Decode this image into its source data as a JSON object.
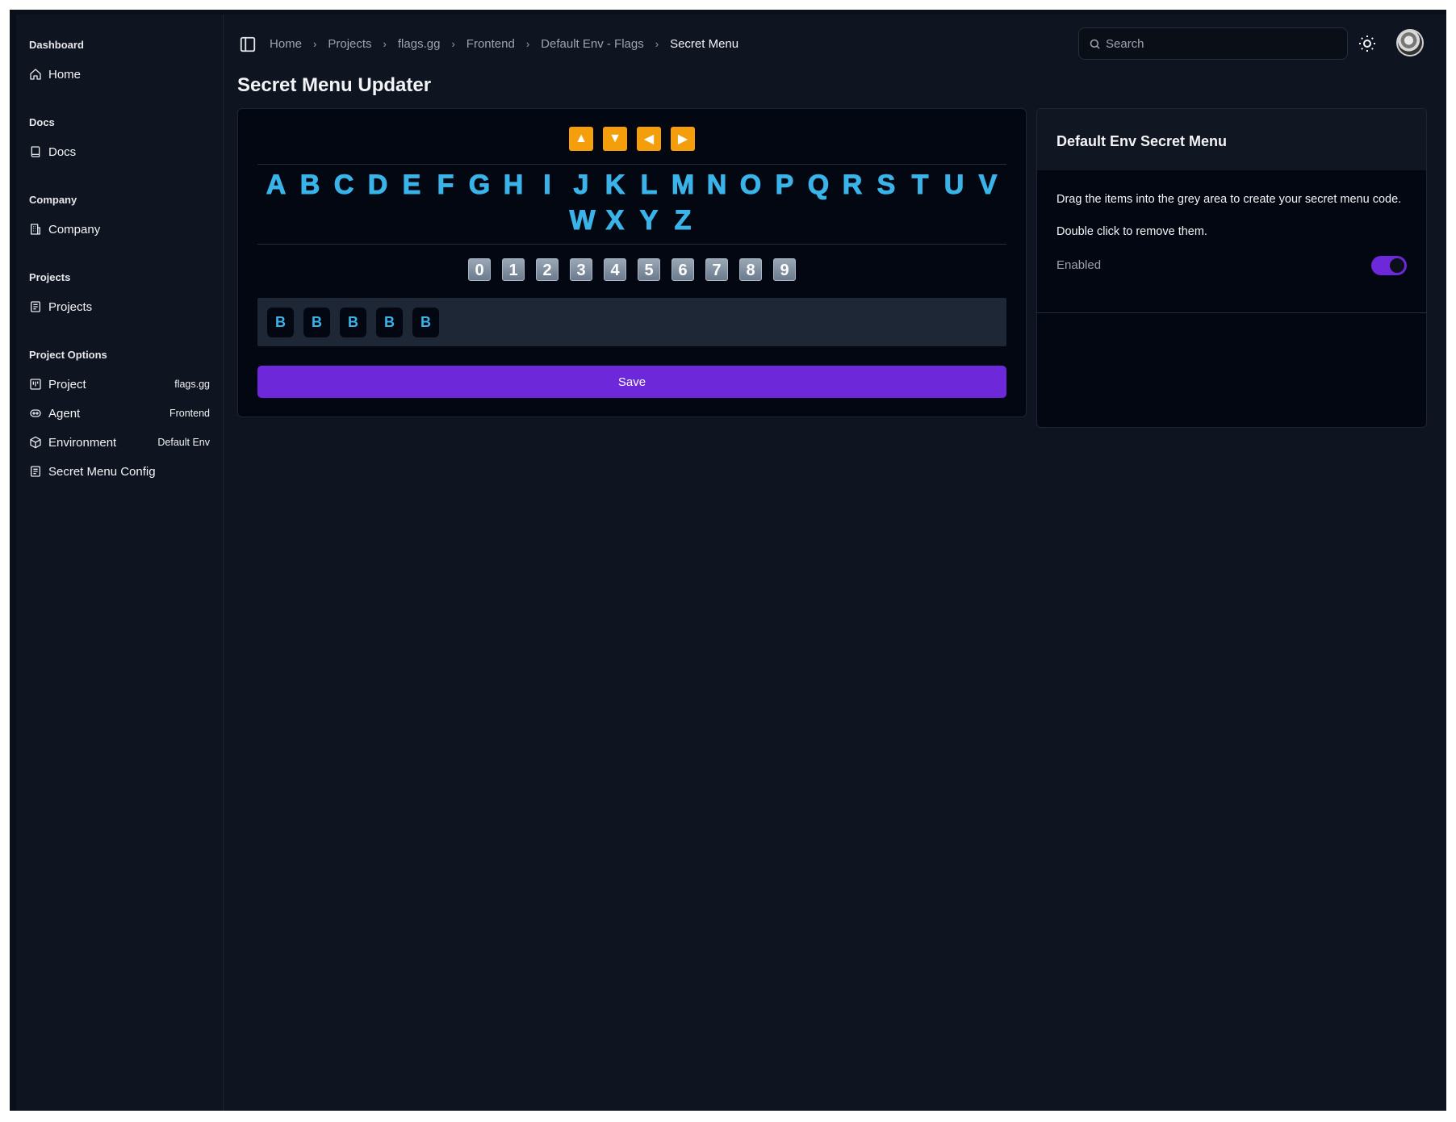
{
  "sidebar": {
    "sections": [
      {
        "label": "Dashboard",
        "items": [
          {
            "label": "Home",
            "icon": "home-icon",
            "meta": ""
          }
        ]
      },
      {
        "label": "Docs",
        "items": [
          {
            "label": "Docs",
            "icon": "book-icon",
            "meta": ""
          }
        ]
      },
      {
        "label": "Company",
        "items": [
          {
            "label": "Company",
            "icon": "building-icon",
            "meta": ""
          }
        ]
      },
      {
        "label": "Projects",
        "items": [
          {
            "label": "Projects",
            "icon": "list-icon",
            "meta": ""
          }
        ]
      },
      {
        "label": "Project Options",
        "items": [
          {
            "label": "Project",
            "icon": "kanban-icon",
            "meta": "flags.gg"
          },
          {
            "label": "Agent",
            "icon": "agent-icon",
            "meta": "Frontend"
          },
          {
            "label": "Environment",
            "icon": "box-icon",
            "meta": "Default Env"
          },
          {
            "label": "Secret Menu Config",
            "icon": "list-icon",
            "meta": ""
          }
        ]
      }
    ]
  },
  "breadcrumb": [
    "Home",
    "Projects",
    "flags.gg",
    "Frontend",
    "Default Env - Flags",
    "Secret Menu"
  ],
  "search": {
    "placeholder": "Search"
  },
  "page_title": "Secret Menu Updater",
  "arrows": [
    "▲",
    "▼",
    "◀",
    "▶"
  ],
  "letters": [
    "A",
    "B",
    "C",
    "D",
    "E",
    "F",
    "G",
    "H",
    "I",
    "J",
    "K",
    "L",
    "M",
    "N",
    "O",
    "P",
    "Q",
    "R",
    "S",
    "T",
    "U",
    "V",
    "W",
    "X",
    "Y",
    "Z"
  ],
  "digits": [
    "0",
    "1",
    "2",
    "3",
    "4",
    "5",
    "6",
    "7",
    "8",
    "9"
  ],
  "sequence": [
    "B",
    "B",
    "B",
    "B",
    "B"
  ],
  "save_label": "Save",
  "right_card": {
    "title": "Default Env Secret Menu",
    "instruction_1": "Drag the items into the grey area to create your secret menu code.",
    "instruction_2": "Double click to remove them.",
    "enabled_label": "Enabled",
    "enabled": true
  },
  "colors": {
    "accent": "#6d28d9",
    "letter": "#3ab4e8",
    "arrow": "#f59e0b"
  }
}
